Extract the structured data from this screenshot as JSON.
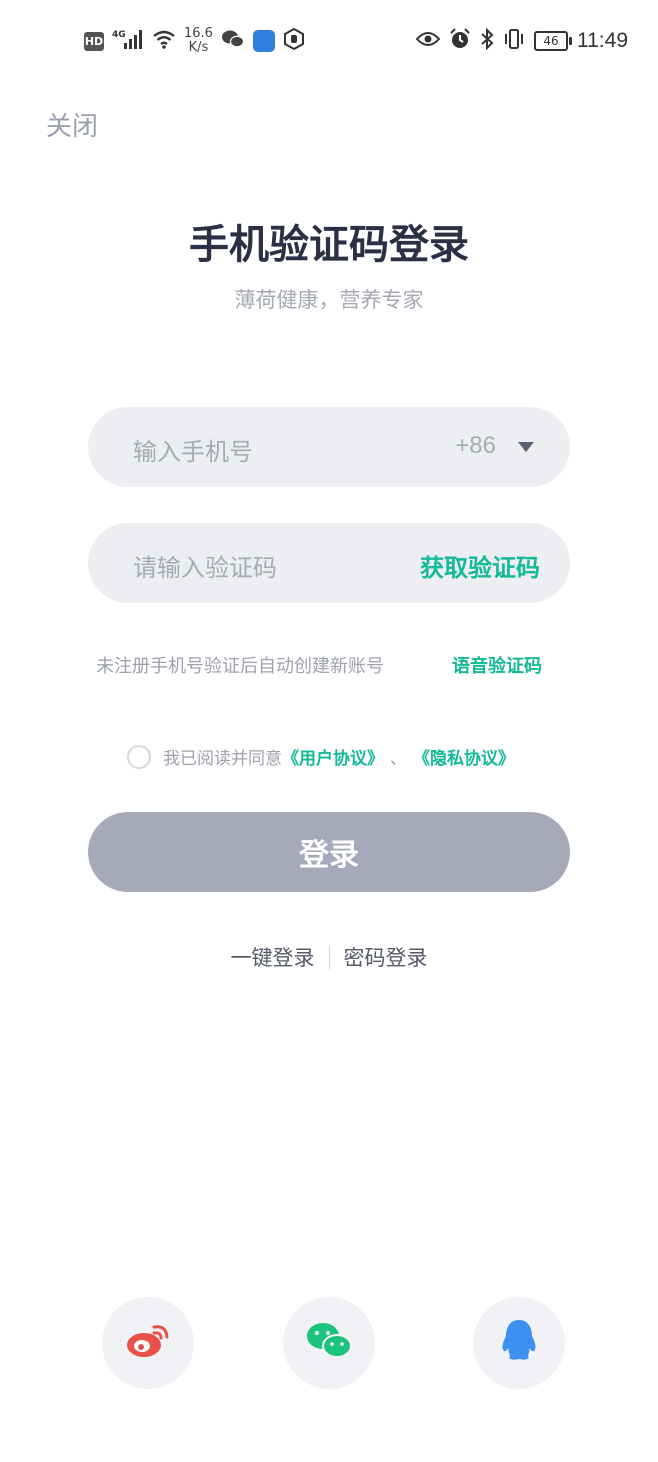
{
  "status_bar": {
    "hd": "HD",
    "network": "4G",
    "speed_value": "16.6",
    "speed_unit": "K/s",
    "battery": "46",
    "time": "11:49"
  },
  "header": {
    "close_label": "关闭"
  },
  "main": {
    "title": "手机验证码登录",
    "subtitle": "薄荷健康，营养专家",
    "phone_placeholder": "输入手机号",
    "country_code": "+86",
    "code_placeholder": "请输入验证码",
    "get_code_label": "获取验证码",
    "hint": "未注册手机号验证后自动创建新账号",
    "voice_code_label": "语音验证码",
    "agree_prefix": "我已阅读并同意",
    "user_agreement": "《用户协议》",
    "agree_separator": "、",
    "privacy_agreement": "《隐私协议》",
    "agree_checked": false,
    "login_label": "登录",
    "one_click_login": "一键登录",
    "password_login": "密码登录"
  },
  "social": {
    "items": [
      "weibo-icon",
      "wechat-icon",
      "qq-icon"
    ]
  },
  "colors": {
    "accent": "#14b997",
    "title": "#2b3044",
    "login_button": "#a5a9b9",
    "field_bg": "#eceef2",
    "weibo": "#e8504a",
    "wechat": "#1cc37a",
    "qq": "#3d8ff2"
  }
}
